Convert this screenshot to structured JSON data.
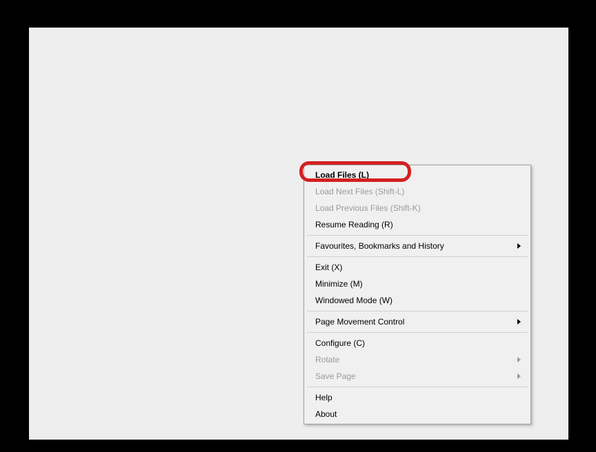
{
  "menu": {
    "items": [
      {
        "label": "Load Files (L)",
        "bold": true,
        "disabled": false,
        "submenu": false
      },
      {
        "label": "Load Next Files (Shift-L)",
        "bold": false,
        "disabled": true,
        "submenu": false
      },
      {
        "label": "Load Previous Files (Shift-K)",
        "bold": false,
        "disabled": true,
        "submenu": false
      },
      {
        "label": "Resume Reading (R)",
        "bold": false,
        "disabled": false,
        "submenu": false
      },
      {
        "separator": true
      },
      {
        "label": "Favourites, Bookmarks and History",
        "bold": false,
        "disabled": false,
        "submenu": true
      },
      {
        "separator": true
      },
      {
        "label": "Exit (X)",
        "bold": false,
        "disabled": false,
        "submenu": false
      },
      {
        "label": "Minimize (M)",
        "bold": false,
        "disabled": false,
        "submenu": false
      },
      {
        "label": "Windowed Mode (W)",
        "bold": false,
        "disabled": false,
        "submenu": false
      },
      {
        "separator": true
      },
      {
        "label": "Page Movement Control",
        "bold": false,
        "disabled": false,
        "submenu": true
      },
      {
        "separator": true
      },
      {
        "label": "Configure (C)",
        "bold": false,
        "disabled": false,
        "submenu": false
      },
      {
        "label": "Rotate",
        "bold": false,
        "disabled": true,
        "submenu": true
      },
      {
        "label": "Save Page",
        "bold": false,
        "disabled": true,
        "submenu": true
      },
      {
        "separator": true
      },
      {
        "label": "Help",
        "bold": false,
        "disabled": false,
        "submenu": false
      },
      {
        "label": "About",
        "bold": false,
        "disabled": false,
        "submenu": false
      }
    ]
  }
}
